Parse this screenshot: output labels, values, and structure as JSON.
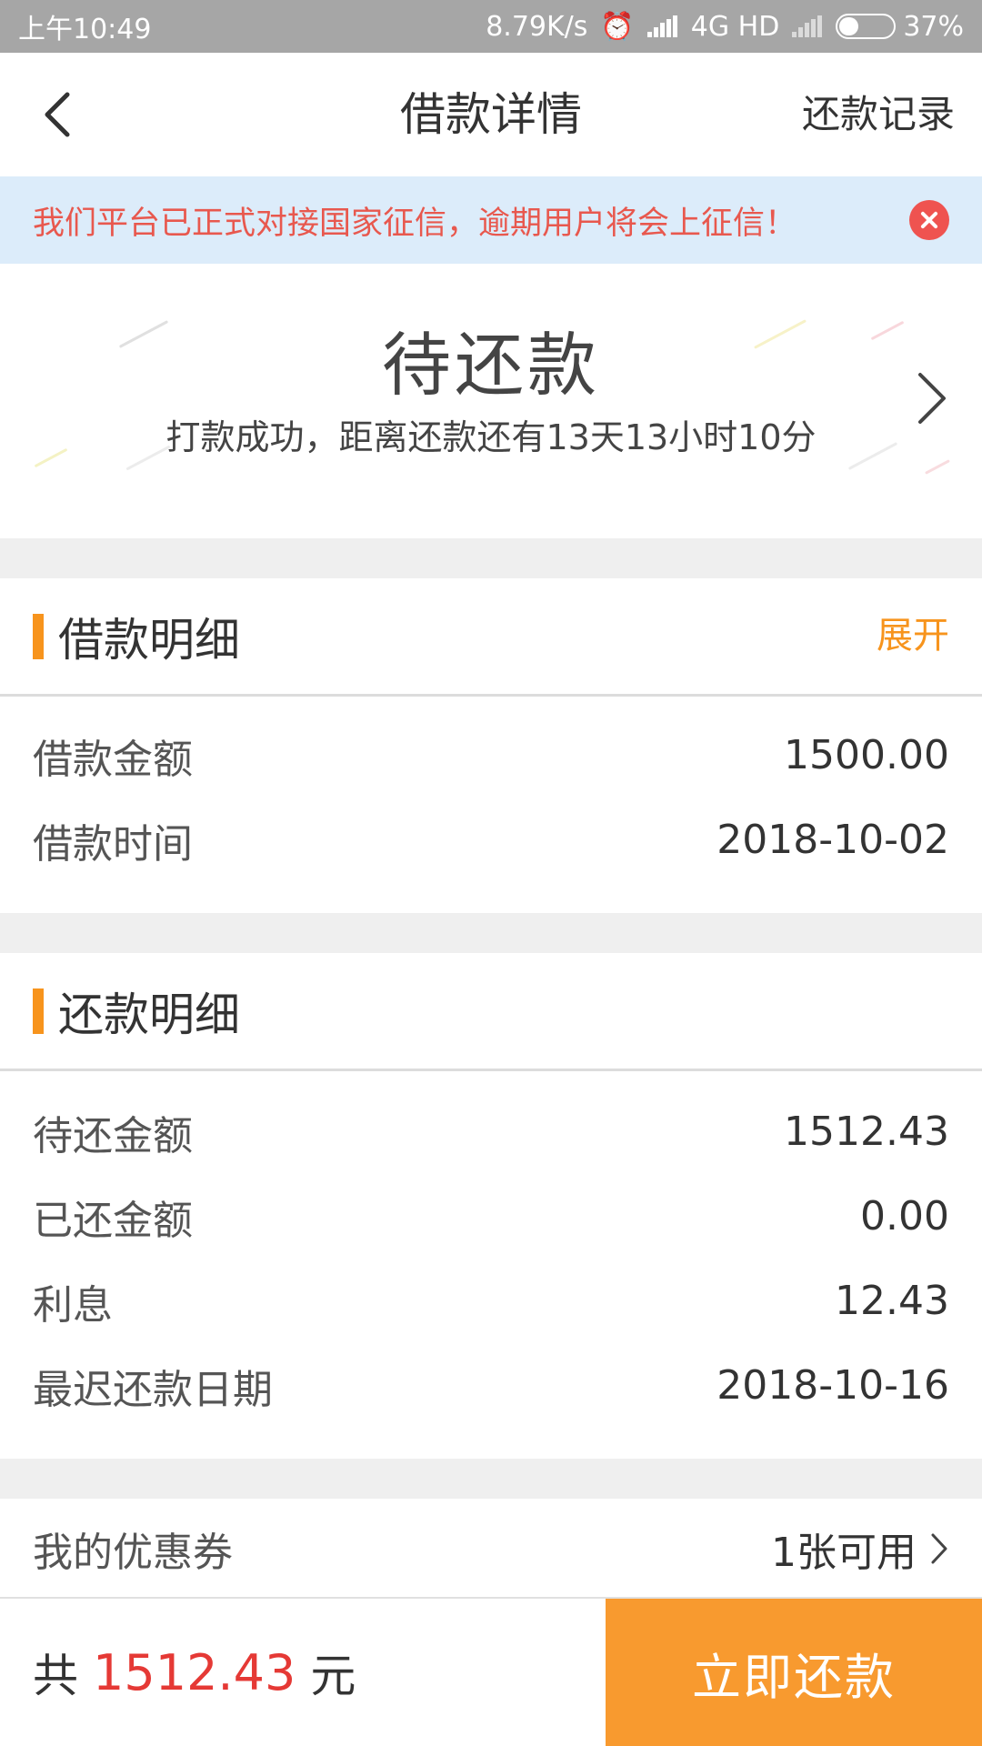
{
  "status_bar": {
    "time": "上午10:49",
    "speed": "8.79K/s",
    "network": "4G HD",
    "battery": "37%",
    "battery_level": 0.37
  },
  "nav": {
    "title": "借款详情",
    "record_link": "还款记录"
  },
  "notice": {
    "text": "我们平台已正式对接国家征信，逾期用户将会上征信！"
  },
  "status_card": {
    "state": "待还款",
    "subtitle": "打款成功，距离还款还有13天13小时10分"
  },
  "loan_section": {
    "title": "借款明细",
    "toggle": "展开",
    "rows": [
      {
        "label": "借款金额",
        "value": "1500.00"
      },
      {
        "label": "借款时间",
        "value": "2018-10-02"
      }
    ]
  },
  "repay_section": {
    "title": "还款明细",
    "rows": [
      {
        "label": "待还金额",
        "value": "1512.43"
      },
      {
        "label": "已还金额",
        "value": "0.00"
      },
      {
        "label": "利息",
        "value": "12.43"
      },
      {
        "label": "最迟还款日期",
        "value": "2018-10-16"
      }
    ]
  },
  "coupon": {
    "label": "我的优惠券",
    "value": "1张可用"
  },
  "bottom_bar": {
    "prefix": "共",
    "amount": "1512.43",
    "unit": "元",
    "pay_button": "立即还款"
  },
  "colors": {
    "accent": "#f7941d",
    "pay_button": "#f89a2f",
    "amount": "#e53935",
    "notice_bg": "#dcecfa",
    "notice_text": "#e8584e"
  }
}
